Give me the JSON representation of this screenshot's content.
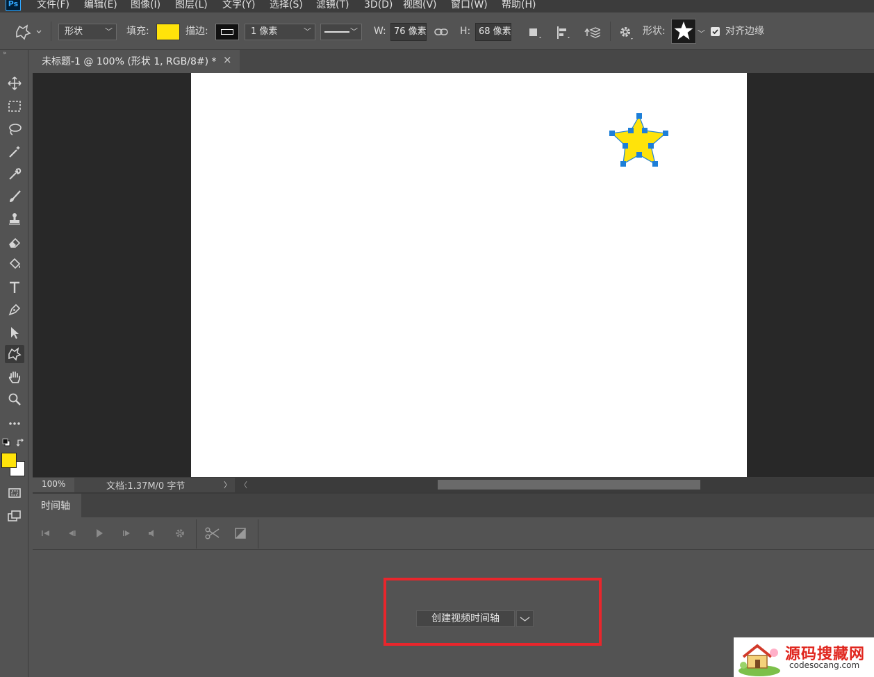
{
  "app": {
    "logo": "Ps"
  },
  "menu": [
    "文件(F)",
    "编辑(E)",
    "图像(I)",
    "图层(L)",
    "文字(Y)",
    "选择(S)",
    "滤镜(T)",
    "3D(D)",
    "视图(V)",
    "窗口(W)",
    "帮助(H)"
  ],
  "options": {
    "mode_value": "形状",
    "fill_label": "填充:",
    "fill_color": "#ffe30a",
    "stroke_label": "描边:",
    "stroke_width_value": "1 像素",
    "width_label": "W:",
    "width_value": "76 像素",
    "height_label": "H:",
    "height_value": "68 像素",
    "shape_label": "形状:",
    "align_edges_label": "对齐边缘",
    "align_edges_checked": true
  },
  "document": {
    "tab_title": "未标题-1 @ 100% (形状 1, RGB/8#) *",
    "close_glyph": "×",
    "star_fill": "#ffe30a",
    "anchor_color": "#1e7fd8"
  },
  "status": {
    "zoom": "100%",
    "doc_info": "文档:1.37M/0 字节",
    "next_glyph": "〉",
    "prev_glyph": "〈"
  },
  "timeline": {
    "tab_label": "时间轴",
    "create_button_label": "创建视频时间轴",
    "highlight_color": "#e8262c"
  },
  "colors": {
    "foreground": "#ffe30a",
    "background": "#ffffff"
  },
  "watermark": {
    "title": "源码搜藏网",
    "url": "codesocang.com"
  }
}
